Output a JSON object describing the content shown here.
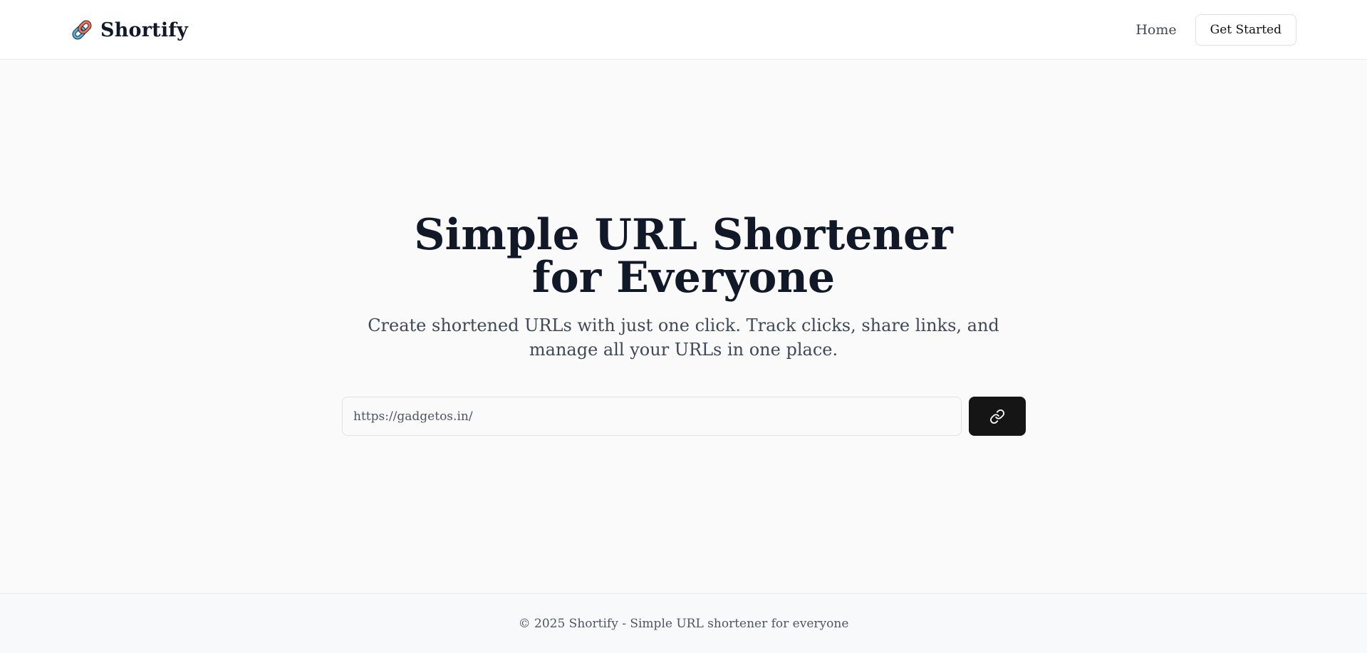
{
  "header": {
    "brand_name": "Shortify",
    "brand_icon": "link-icon",
    "nav": {
      "home_label": "Home",
      "get_started_label": "Get Started"
    }
  },
  "hero": {
    "title_line1": "Simple URL Shortener",
    "title_line2": "for Everyone",
    "subtitle": "Create shortened URLs with just one click. Track clicks, share links, and manage all your URLs in one place."
  },
  "shorten_form": {
    "url_value": "https://gadgetos.in/",
    "submit_icon": "link-icon"
  },
  "footer": {
    "text": "© 2025 Shortify - Simple URL shortener for everyone"
  },
  "colors": {
    "background": "#fafafa",
    "text_primary": "#111827",
    "text_secondary": "#3f4856",
    "button_dark": "#151515"
  }
}
